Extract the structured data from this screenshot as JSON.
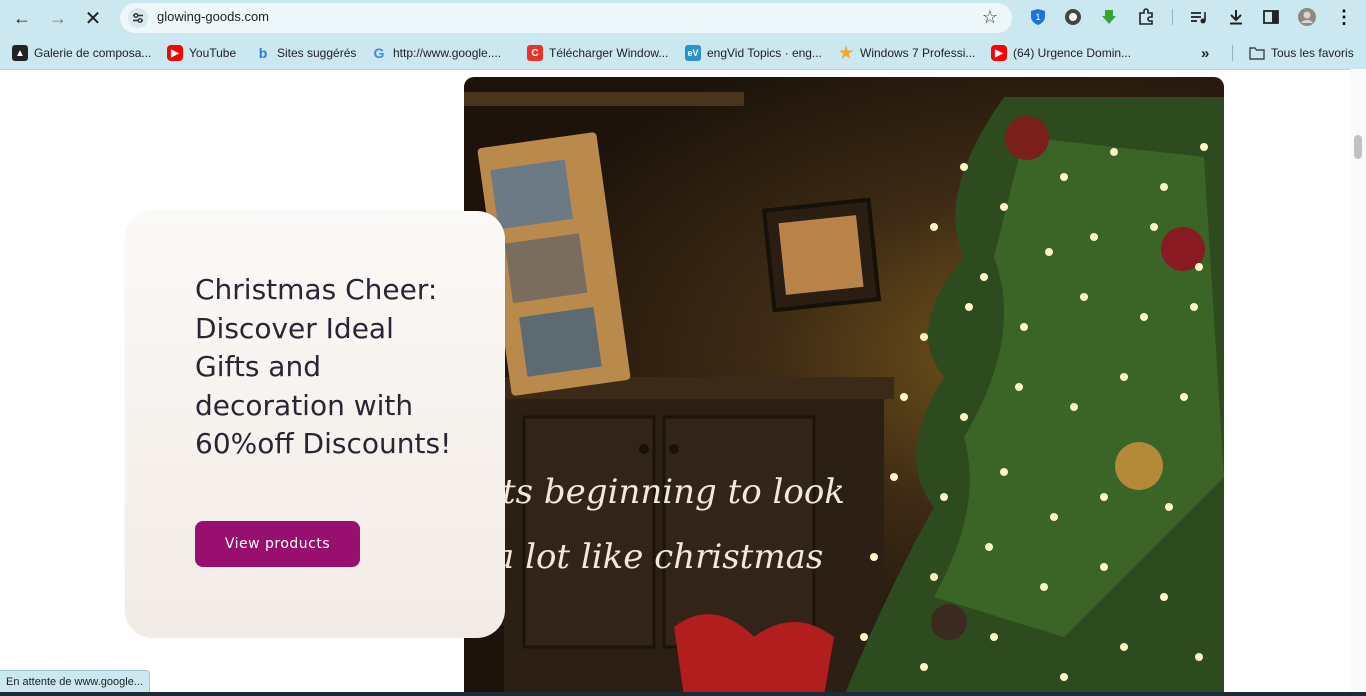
{
  "browser": {
    "url": "glowing-goods.com",
    "status_text": "En attente de www.google...",
    "bookmarks": [
      {
        "label": "Galerie de composa...",
        "icon": "galerie-icon",
        "color": "#222222"
      },
      {
        "label": "YouTube",
        "icon": "youtube-icon",
        "color": "#ff0000"
      },
      {
        "label": "Sites suggérés",
        "icon": "bing-icon",
        "color": "#2b7be4"
      },
      {
        "label": "http://www.google....",
        "icon": "google-icon",
        "color": "#4285f4"
      },
      {
        "label": "Télécharger Window...",
        "icon": "c-icon",
        "color": "#e5352b"
      },
      {
        "label": "engVid Topics · eng...",
        "icon": "engvid-icon",
        "color": "#2b93c9"
      },
      {
        "label": "Windows 7 Professi...",
        "icon": "star-icon",
        "color": "#f5a623"
      },
      {
        "label": "(64) Urgence Domin...",
        "icon": "youtube-icon",
        "color": "#ff0000"
      }
    ],
    "all_bookmarks_label": "Tous les favoris"
  },
  "hero": {
    "heading": "Christmas Cheer: Discover Ideal Gifts and decoration with 60%off Discounts!",
    "button_label": "View products",
    "image_text_line1": "ts beginning to look",
    "image_text_line2": "a lot like christmas"
  },
  "colors": {
    "chrome": "#cbe8f0",
    "accent": "#990f6f",
    "heading": "#2a2535"
  }
}
